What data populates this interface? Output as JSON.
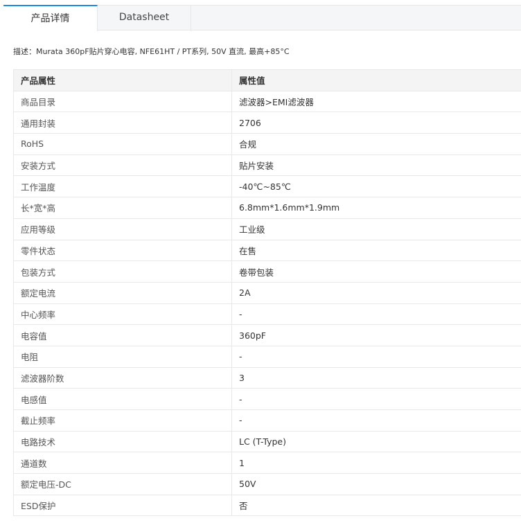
{
  "tabs": [
    {
      "label": "产品详情",
      "active": true
    },
    {
      "label": "Datasheet",
      "active": false
    }
  ],
  "description": "描述：Murata 360pF贴片穿心电容, NFE61HT / PT系列, 50V 直流, 最高+85°C",
  "table": {
    "headers": [
      "产品属性",
      "属性值"
    ],
    "rows": [
      [
        "商品目录",
        "滤波器>EMI滤波器"
      ],
      [
        "通用封装",
        "2706"
      ],
      [
        "RoHS",
        "合规"
      ],
      [
        "安装方式",
        "贴片安装"
      ],
      [
        "工作温度",
        "-40℃~85℃"
      ],
      [
        "长*宽*高",
        "6.8mm*1.6mm*1.9mm"
      ],
      [
        "应用等级",
        "工业级"
      ],
      [
        "零件状态",
        "在售"
      ],
      [
        "包装方式",
        "卷带包装"
      ],
      [
        "额定电流",
        "2A"
      ],
      [
        "中心频率",
        "-"
      ],
      [
        "电容值",
        "360pF"
      ],
      [
        "电阻",
        "-"
      ],
      [
        "滤波器阶数",
        "3"
      ],
      [
        "电感值",
        "-"
      ],
      [
        "截止频率",
        "-"
      ],
      [
        "电路技术",
        "LC (T-Type)"
      ],
      [
        "通道数",
        "1"
      ],
      [
        "额定电压-DC",
        "50V"
      ],
      [
        "ESD保护",
        "否"
      ]
    ]
  }
}
